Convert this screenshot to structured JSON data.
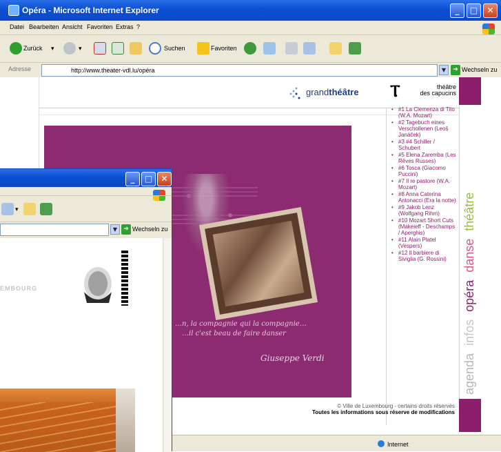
{
  "back_window": {
    "title": "Opéra - Microsoft Internet Explorer",
    "menu": [
      "Datei",
      "Bearbeiten",
      "Ansicht",
      "Favoriten",
      "Extras",
      "?"
    ],
    "toolbar": {
      "back_label": "Zurück",
      "search_label": "Suchen",
      "favorites_label": "Favoriten"
    },
    "address": {
      "label": "Adresse",
      "url": "http://www.theater-vdl.lu/opéra",
      "go_label": "Wechseln zu"
    },
    "page": {
      "grandtheatre_logo_light": "grand",
      "grandtheatre_logo_bold": "théâtre",
      "capucins_logo_top": "théâtre",
      "capucins_logo_bottom": "des capucins",
      "side_nav": [
        "agenda",
        "infos",
        "opéra",
        "danse",
        "théâtre"
      ],
      "hero_quote_1": "…n, la compagnie qui la compagnie…",
      "hero_quote_2": "…il c'est beau de faire danser",
      "hero_signature": "Giuseppe Verdi",
      "productions": [
        "#1 La Clemenza di Tito (W.A. Mozart)",
        "#2 Tagebuch eines Verschollenen (Leoš Janáček)",
        "#3 #4 Schiller / Schubert",
        "#5 Elena Zaremba (Les Rêves Russes)",
        "#6 Tosca (Giacomo Puccini)",
        "#7 Il re pastore (W.A. Mozart)",
        "#8 Anna Caterina Antonacci (Era la notte)",
        "#9 Jakob Lenz (Wolfgang Rihm)",
        "#10 Mozart Short Cuts (Makeieff - Deschamps / Aperghis)",
        "#11 Alain Platel (Vespers)",
        "#12 Il barbiere di Siviglia (G. Rossini)"
      ],
      "footer_line1": "© Ville de Luxembourg - certains droits réservés",
      "footer_line2": "Toutes les informations sous réserve de modifications"
    },
    "status": {
      "zone": "Internet"
    }
  },
  "front_window": {
    "address_go_label": "Wechseln zu",
    "page_text": "EMBOURG"
  },
  "colors": {
    "accent_purple": "#8b1e6a",
    "xp_title_blue": "#0c4fd3"
  }
}
